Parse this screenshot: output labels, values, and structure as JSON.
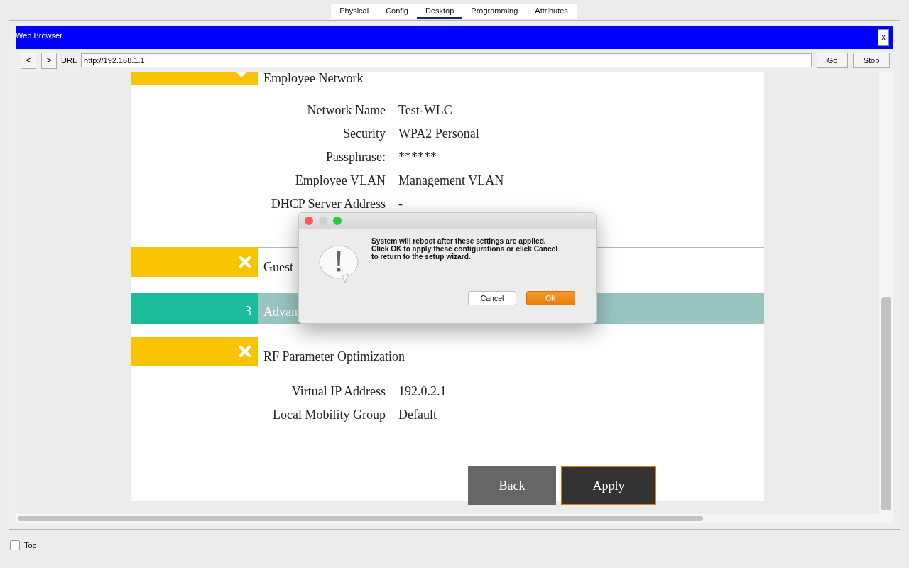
{
  "tabs": [
    {
      "label": "Physical",
      "selected": false
    },
    {
      "label": "Config",
      "selected": false
    },
    {
      "label": "Desktop",
      "selected": true
    },
    {
      "label": "Programming",
      "selected": false
    },
    {
      "label": "Attributes",
      "selected": false
    }
  ],
  "browser": {
    "title": "Web Browser",
    "close": "X",
    "back": "<",
    "forward": ">",
    "url_label": "URL",
    "url": "http://192.168.1.1",
    "go": "Go",
    "stop": "Stop"
  },
  "sections": [
    {
      "kind": "expanded",
      "title": "Employee Network",
      "fields": [
        {
          "label": "Network Name",
          "value": "Test-WLC"
        },
        {
          "label": "Security",
          "value": "WPA2 Personal"
        },
        {
          "label": "Passphrase:",
          "value": "******"
        },
        {
          "label": "Employee VLAN",
          "value": "Management VLAN"
        },
        {
          "label": "DHCP Server Address",
          "value": "-"
        }
      ]
    },
    {
      "kind": "done",
      "title": "Guest"
    },
    {
      "kind": "current",
      "number": "3",
      "title": "Advan"
    },
    {
      "kind": "done",
      "title": "RF Parameter Optimization",
      "fields": [
        {
          "label": "Virtual IP Address",
          "value": "192.0.2.1"
        },
        {
          "label": "Local Mobility Group",
          "value": "Default"
        }
      ]
    }
  ],
  "actions": {
    "back": "Back",
    "apply": "Apply"
  },
  "dialog": {
    "lines": [
      "System will reboot after these settings are applied.",
      "Click OK to apply these configurations or click Cancel",
      "to return to the setup wizard."
    ],
    "cancel": "Cancel",
    "ok": "OK"
  },
  "footer": {
    "label": "Top",
    "checked": false
  }
}
